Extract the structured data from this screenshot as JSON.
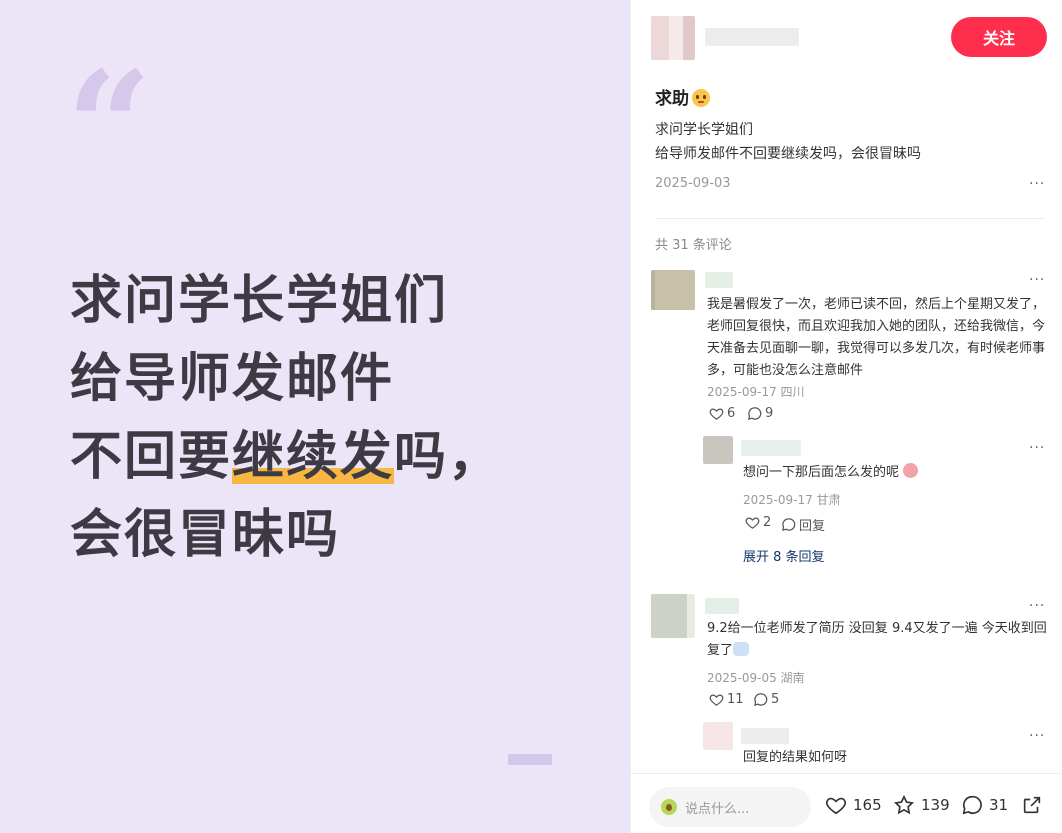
{
  "cover": {
    "quote_mark": "“",
    "line1": "求问学长学姐们",
    "line2": "给导师发邮件",
    "line3_pre": "不回要",
    "line3_hl": "继续发",
    "line3_post": "吗，",
    "line4": "会很冒昧吗"
  },
  "header": {
    "follow_label": "关注"
  },
  "post": {
    "title": "求助",
    "title_emoji": "pleading-face",
    "body_line1": "求问学长学姐们",
    "body_line2": "给导师发邮件不回要继续发吗，会很冒昧吗",
    "date": "2025-09-03",
    "more": "···"
  },
  "comments_header": "共 31 条评论",
  "comments": [
    {
      "text": "我是暑假发了一次，老师已读不回，然后上个星期又发了，老师回复很快，而且欢迎我加入她的团队，还给我微信，今天准备去见面聊一聊，我觉得可以多发几次，有时候老师事多，可能也没怎么注意邮件",
      "meta": "2025-09-17 四川",
      "likes": "6",
      "replies": "9",
      "more": "···"
    },
    {
      "text": "想问一下那后面怎么发的呢",
      "meta": "2025-09-17 甘肃",
      "likes": "2",
      "reply_label": "回复",
      "more": "···"
    },
    {
      "text": "9.2给一位老师发了简历 没回复 9.4又发了一遍 今天收到回复了",
      "meta": "2025-09-05 湖南",
      "likes": "11",
      "replies": "5",
      "more": "···"
    },
    {
      "text": "回复的结果如何呀",
      "more": "···"
    }
  ],
  "expand_label": "展开 8 条回复",
  "bottom": {
    "input_placeholder": "说点什么...",
    "likes": "165",
    "stars": "139",
    "comments": "31"
  }
}
